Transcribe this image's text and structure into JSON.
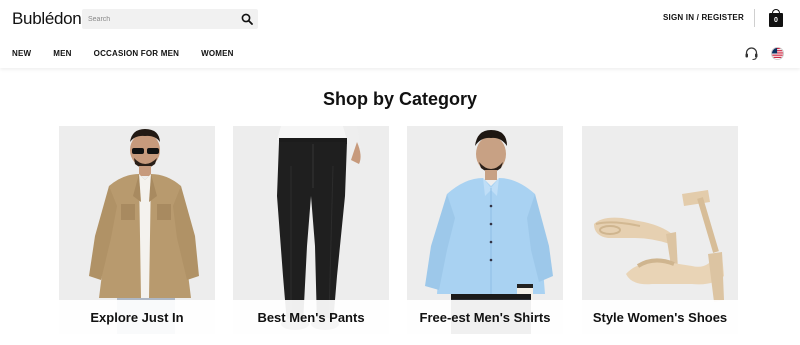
{
  "header": {
    "logo": "Bublédon",
    "search": {
      "placeholder": "Search"
    },
    "account_link": "SIGN IN / REGISTER",
    "cart_count": "0"
  },
  "nav": {
    "items": [
      "NEW",
      "MEN",
      "OCCASION FOR MEN",
      "WOMEN"
    ]
  },
  "icons": {
    "search": "search-icon",
    "cart": "shopping-bag-icon",
    "support": "headset-icon",
    "region": "us-flag-icon"
  },
  "main": {
    "title": "Shop by Category",
    "categories": [
      {
        "label": "Explore Just In"
      },
      {
        "label": "Best Men's Pants"
      },
      {
        "label": "Free-est Men's Shirts"
      },
      {
        "label": "Style Women's Shoes"
      }
    ]
  },
  "colors": {
    "text": "#111111",
    "card_background": "#ececec",
    "khaki_shirt": "#b89a6e",
    "blue_shirt": "#a9d2f2",
    "nude_heel": "#e6d0b1"
  }
}
